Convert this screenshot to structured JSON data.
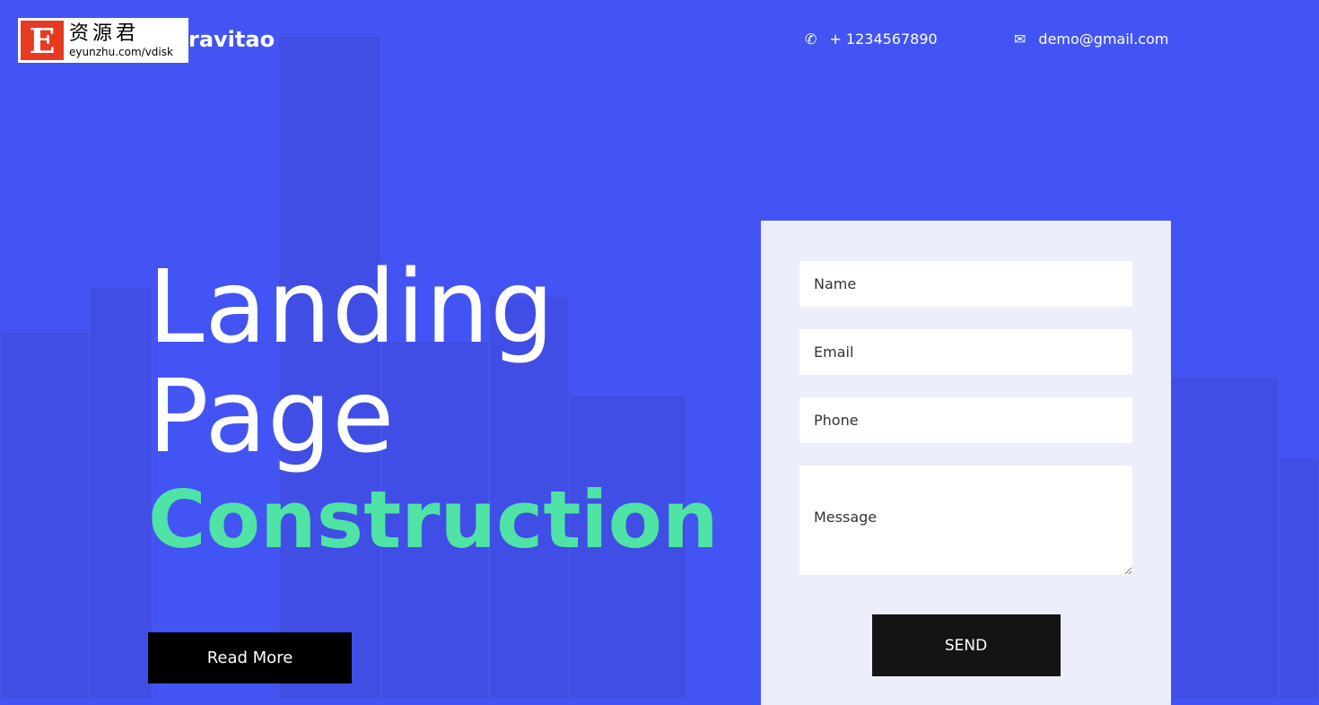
{
  "watermark": {
    "letter": "E",
    "chinese": "资源君",
    "url": "eyunzhu.com/vdisk"
  },
  "header": {
    "logo": "ravitao",
    "phone": "+ 1234567890",
    "email": "demo@gmail.com",
    "phone_icon": "phone-icon",
    "email_icon": "envelope-icon"
  },
  "hero": {
    "line1": "Landing",
    "line2": "Page",
    "highlight": "Construction",
    "button": "Read More"
  },
  "form": {
    "name_placeholder": "Name",
    "email_placeholder": "Email",
    "phone_placeholder": "Phone",
    "message_placeholder": "Message",
    "submit": "SEND"
  },
  "colors": {
    "background": "#4354f5",
    "accent": "#4fe3a6",
    "form_bg": "#eceefb"
  }
}
